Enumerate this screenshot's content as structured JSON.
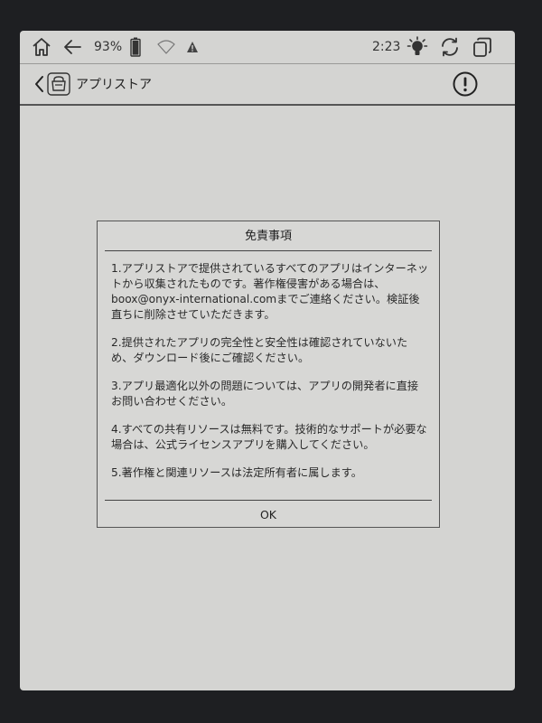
{
  "status_bar": {
    "battery_percent": "93%",
    "time": "2:23"
  },
  "title_bar": {
    "title": "アプリストア"
  },
  "dialog": {
    "title": "免責事項",
    "paragraphs": [
      "1.アプリストアで提供されているすべてのアプリはインターネットから収集されたものです。著作権侵害がある場合は、boox@onyx-international.comまでご連絡ください。検証後直ちに削除させていただきます。",
      "2.提供されたアプリの完全性と安全性は確認されていないため、ダウンロード後にご確認ください。",
      "3.アプリ最適化以外の問題については、アプリの開発者に直接お問い合わせください。",
      "4.すべての共有リソースは無料です。技術的なサポートが必要な場合は、公式ライセンスアプリを購入してください。",
      "5.著作権と関連リソースは法定所有者に属します。"
    ],
    "ok_label": "OK"
  }
}
